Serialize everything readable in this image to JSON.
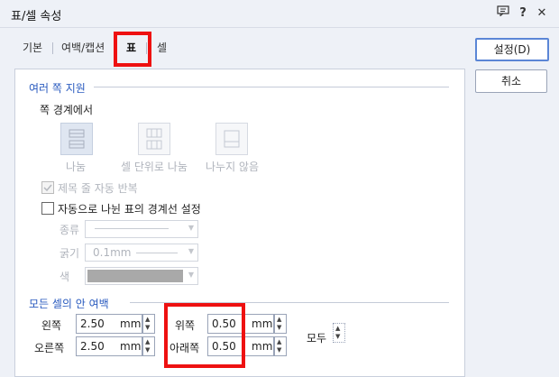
{
  "window": {
    "title": "표/셀 속성",
    "help": "?",
    "close": "✕"
  },
  "tabs": [
    {
      "label": "기본"
    },
    {
      "label": "여백/캡션"
    },
    {
      "label": "표"
    },
    {
      "label": "셀"
    }
  ],
  "buttons": {
    "ok": "설정(D)",
    "cancel": "취소"
  },
  "multi_page": {
    "title": "여러 쪽 지원",
    "boundary_label": "쪽 경계에서",
    "options": [
      {
        "label": "나눔"
      },
      {
        "label": "셀 단위로 나눔"
      },
      {
        "label": "나누지 않음"
      }
    ],
    "repeat_header": "제목 줄 자동 반복",
    "auto_border": "자동으로 나뉜 표의 경계선 설정",
    "type_label": "종류",
    "thickness_label": "굵기",
    "thickness_value": "0.1mm",
    "color_label": "색"
  },
  "inner_margin": {
    "title": "모든 셀의 안 여백",
    "left_label": "왼쪽",
    "left_value": "2.50",
    "right_label": "오른쪽",
    "right_value": "2.50",
    "top_label": "위쪽",
    "top_value": "0.50",
    "bottom_label": "아래쪽",
    "bottom_value": "0.50",
    "unit": "mm",
    "all_label": "모두"
  },
  "colors": {
    "accent": "#2a5bbf",
    "highlight": "#ee1111",
    "swatch": "#a9a9a9"
  }
}
